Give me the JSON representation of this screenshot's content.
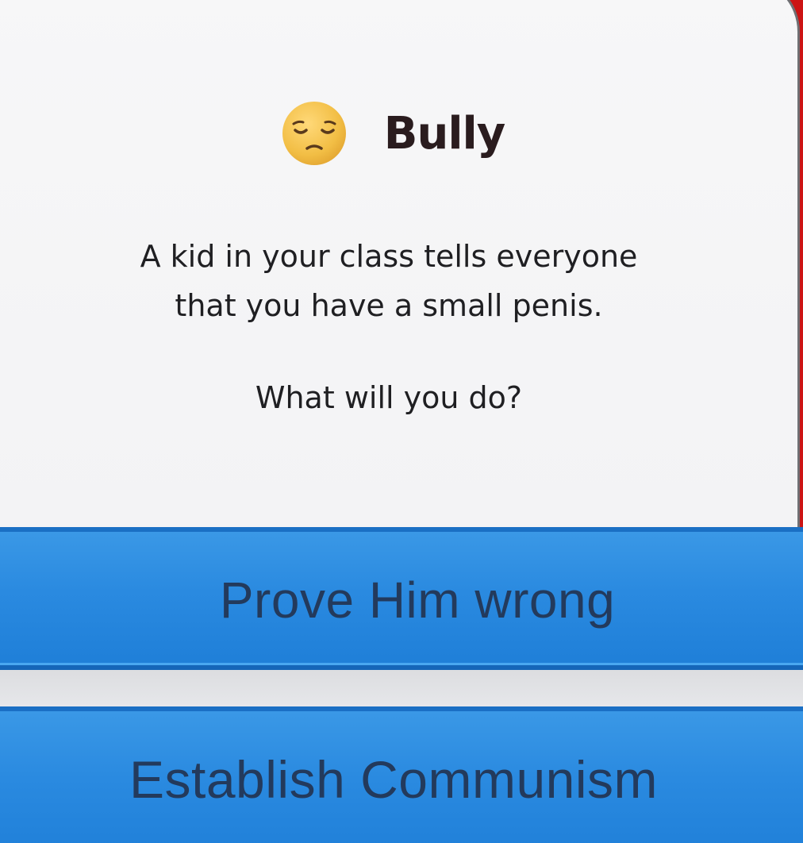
{
  "event": {
    "icon": "pensive-face-emoji-icon",
    "title": "Bully",
    "message_line1": "A kid in your class tells everyone",
    "message_line2": "that you have a small penis.",
    "question": "What will you do?"
  },
  "choices": [
    {
      "label": "Prove Him wrong"
    },
    {
      "label": "Establish Communism"
    }
  ],
  "colors": {
    "background_red": "#cc1414",
    "card": "#f5f5f7",
    "choice_blue": "#2a8ae0",
    "choice_text": "#233a5c",
    "title_text": "#2a1c1e",
    "emoji_yellow": "#f4c24a"
  }
}
